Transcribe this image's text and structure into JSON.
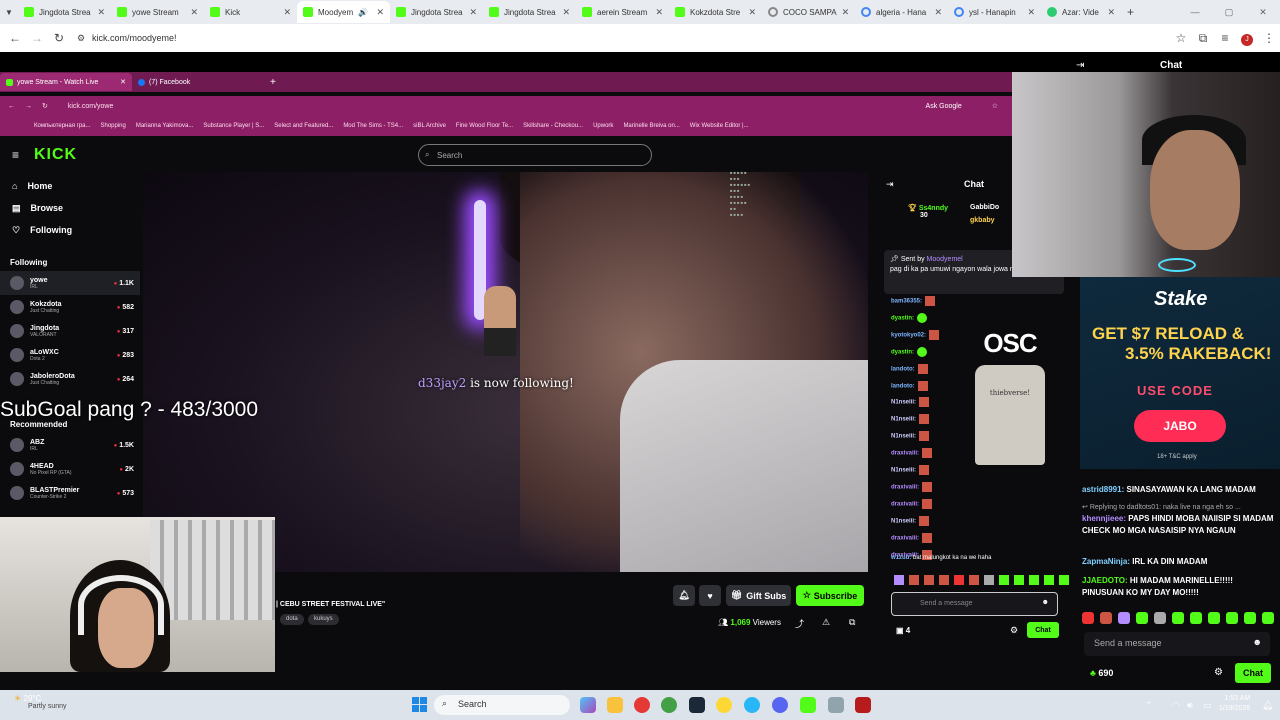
{
  "browser": {
    "tabs": [
      {
        "label": "Jingdota Strea",
        "icon": "kick-favicon",
        "active": false
      },
      {
        "label": "yowe Stream",
        "icon": "kick-favicon",
        "active": false
      },
      {
        "label": "Kick",
        "icon": "kick-favicon",
        "active": false
      },
      {
        "label": "Moodyem",
        "icon": "kick-favicon",
        "active": true
      },
      {
        "label": "Jingdota Strea",
        "icon": "kick-favicon",
        "active": false
      },
      {
        "label": "Jingdota Strea",
        "icon": "kick-favicon",
        "active": false
      },
      {
        "label": "aerein Stream",
        "icon": "kick-favicon",
        "active": false
      },
      {
        "label": "Kokzdota Stre",
        "icon": "kick-favicon",
        "active": false
      },
      {
        "label": "COCO SAMPA",
        "icon": "globe-icon",
        "active": false
      },
      {
        "label": "algeria - Hana",
        "icon": "google-icon",
        "active": false
      },
      {
        "label": "ysl - Hanapin",
        "icon": "google-icon",
        "active": false
      },
      {
        "label": "Azar: Vide",
        "icon": "azar-icon",
        "active": false
      }
    ],
    "url": "kick.com/moodyeme!"
  },
  "inner_browser": {
    "tabs": [
      {
        "label": "yowe Stream - Watch Live",
        "active": true
      },
      {
        "label": "(7) Facebook",
        "active": false
      }
    ],
    "url": "kick.com/yowe",
    "ask_google": "Ask Google",
    "bookmarks": [
      "Компьютерная гра...",
      "Shopping",
      "Marianna Yakimova...",
      "Substance Player | S...",
      "Select and Featured...",
      "Mod The Sims - TS4...",
      "siBL Archive",
      "Fine Wood Floor Te...",
      "Skillshare - Checkou...",
      "Upwork",
      "Marinelle Breiva on...",
      "Wix Website Editor |..."
    ]
  },
  "kick": {
    "search_placeholder": "Search",
    "nav": [
      {
        "label": "Home",
        "icon": "home-icon"
      },
      {
        "label": "Browse",
        "icon": "browse-icon"
      },
      {
        "label": "Following",
        "icon": "heart-icon"
      }
    ],
    "following_label": "Following",
    "following": [
      {
        "name": "yowe",
        "sub": "IRL",
        "count": "1.1K"
      },
      {
        "name": "Kokzdota",
        "sub": "Just Chatting",
        "count": "582"
      },
      {
        "name": "Jingdota",
        "sub": "VALORANT",
        "count": "317"
      },
      {
        "name": "aLoWXC",
        "sub": "Dota 2",
        "count": "283"
      },
      {
        "name": "JaboleroDota",
        "sub": "Just Chatting",
        "count": "264"
      }
    ],
    "recommended_label": "Recommended",
    "recommended": [
      {
        "name": "ABZ",
        "sub": "IRL",
        "count": "1.5K"
      },
      {
        "name": "4HEAD",
        "sub": "No Pixel RP (GTA)",
        "count": "2K"
      },
      {
        "name": "BLASTPremier",
        "sub": "Counter-Strike 2",
        "count": "573"
      }
    ],
    "stream_title": "| CEBU STREET FESTIVAL LIVE\"",
    "tags": [
      "dota",
      "kukuys"
    ],
    "gift_subs": "Gift Subs",
    "subscribe": "Subscribe",
    "viewers": "1,069",
    "viewers_label": "Viewers"
  },
  "overlay": {
    "follow_user": "d33jay2",
    "follow_text": "is now following!",
    "subgoal": "SubGoal pang ? - 483/3000"
  },
  "inner_chat": {
    "title": "Chat",
    "top_gifter": {
      "name": "Ss4nndy",
      "count": "30"
    },
    "gifters": [
      "GabbiDo",
      "gkbaby"
    ],
    "pinned_sent_by": "Sent by",
    "pinned_user": "Moodyemel",
    "pinned_text": "pag di ka pa umuwi ngayon wala jowa ngayon",
    "messages": [
      {
        "user": "bam36355:",
        "color": "#7fb6ff"
      },
      {
        "user": "dyastin:",
        "color": "#53fc18"
      },
      {
        "user": "kyotokyo02:",
        "color": "#7fb6ff"
      },
      {
        "user": "dyastin:",
        "color": "#53fc18"
      },
      {
        "user": "landoto:",
        "color": "#7fb6ff"
      },
      {
        "user": "landoto:",
        "color": "#7fb6ff"
      },
      {
        "user": "N1nseiii:",
        "color": "#cfcfff"
      },
      {
        "user": "N1nseiii:",
        "color": "#cfcfff"
      },
      {
        "user": "N1nseiii:",
        "color": "#cfcfff"
      },
      {
        "user": "draxivaiii:",
        "color": "#b38cff"
      },
      {
        "user": "N1nseiii:",
        "color": "#cfcfff"
      },
      {
        "user": "draxivaiii:",
        "color": "#b38cff"
      },
      {
        "user": "draxivaiii:",
        "color": "#b38cff"
      },
      {
        "user": "N1nseiii:",
        "color": "#cfcfff"
      },
      {
        "user": "draxivaiii:",
        "color": "#b38cff"
      },
      {
        "user": "draxivaiii:",
        "color": "#b38cff"
      }
    ],
    "last_user": "w1zuu:",
    "last_text": "bat malungkot ka na we haha",
    "send_placeholder": "Send a message",
    "points": "4",
    "chat_button": "Chat",
    "ad_brand": "OSC",
    "ad_shirt_text": "thiebverse!"
  },
  "right_chat": {
    "title": "Chat",
    "ad": {
      "brand": "Stake",
      "line1": "GET $7 RELOAD &",
      "line2": "3.5% RAKEBACK!",
      "use_code": "USE CODE",
      "code": "JABO",
      "tnc": "18+  T&C apply"
    },
    "messages": [
      {
        "user": "astrid8991:",
        "text": "SINASAYAWAN KA LANG MADAM"
      },
      {
        "user": "khennjieee:",
        "text": "PAPS HINDI MOBA NAIISIP SI MADAM CHECK MO MGA NASAISIP NYA NGAUN"
      },
      {
        "user": "ZapmaNinja:",
        "text": "IRL KA DIN MADAM"
      },
      {
        "user": "JJAEDOTO:",
        "text": "HI MADAM MARINELLE!!!!! PINUSUAN KO MY DAY MO!!!!!"
      }
    ],
    "reply_text": "Replying to dadltots01: naka live na nga eh so ...",
    "send_placeholder": "Send a message",
    "points": "690",
    "chat_button": "Chat"
  },
  "taskbar": {
    "temp": "29°C",
    "weather": "Partly sunny",
    "search": "Search",
    "time": "1:53 AM",
    "date": "1/19/2026"
  }
}
